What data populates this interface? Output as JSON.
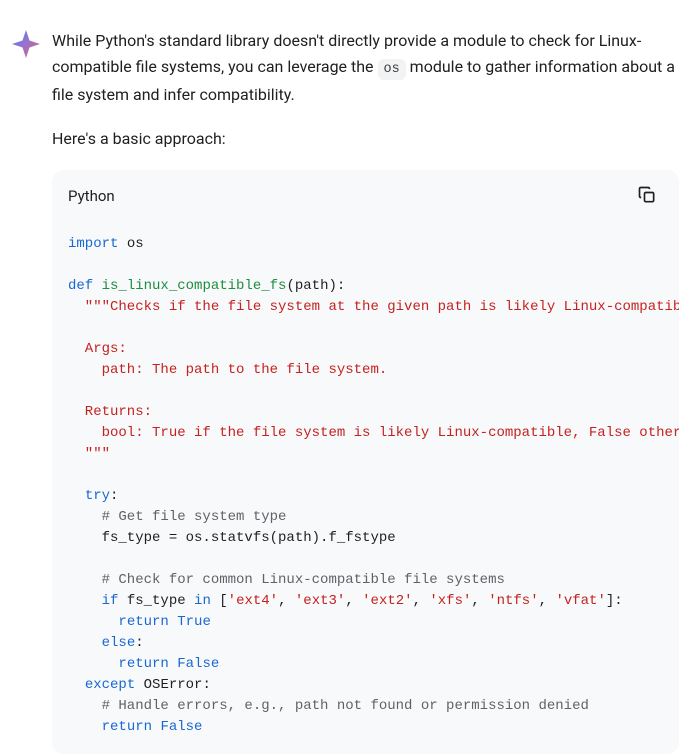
{
  "prose": {
    "p1_a": "While Python's standard library doesn't directly provide a module to check for Linux-compatible file systems, you can leverage the ",
    "inline_code": "os",
    "p1_b": " module to gather information about a file system and infer compatibility.",
    "p2": "Here's a basic approach:"
  },
  "code": {
    "language": "Python",
    "tokens": {
      "import": "import",
      "os1": " os",
      "def": "def",
      "sp1": " ",
      "fn_name": "is_linux_compatible_fs",
      "sig": "(path):",
      "doc_open": "  \"\"\"Checks if the file system at the given path is likely Linux-compatib",
      "doc_args": "  Args:",
      "doc_args_path": "    path: The path to the file system.",
      "doc_returns": "  Returns:",
      "doc_returns_bool": "    bool: True if the file system is likely Linux-compatible, False other",
      "doc_close": "  \"\"\"",
      "try": "try",
      "try_colon": ":",
      "com_get": "    # Get file system type",
      "statvfs": "    fs_type = os.statvfs(path).f_fstype",
      "com_check": "    # Check for common Linux-compatible file systems",
      "if": "if",
      "sp2": " fs_type ",
      "in": "in",
      "sp3": " [",
      "s_ext4": "'ext4'",
      "c1": ", ",
      "s_ext3": "'ext3'",
      "c2": ", ",
      "s_ext2": "'ext2'",
      "c3": ", ",
      "s_xfs": "'xfs'",
      "c4": ", ",
      "s_ntfs": "'ntfs'",
      "c5": ", ",
      "s_vfat": "'vfat'",
      "close_list": "]:",
      "return1": "return",
      "sp4": " ",
      "true": "True",
      "else": "else",
      "else_colon": ":",
      "return2": "return",
      "sp5": " ",
      "false1": "False",
      "except": "except",
      "oserror": " OSError:",
      "com_handle": "    # Handle errors, e.g., path not found or permission denied",
      "return3": "return",
      "sp6": " ",
      "false2": "False",
      "ind2": "  ",
      "ind4": "    ",
      "ind6": "      "
    }
  },
  "icons": {
    "copy": "copy-icon",
    "sparkle": "sparkle-icon"
  }
}
